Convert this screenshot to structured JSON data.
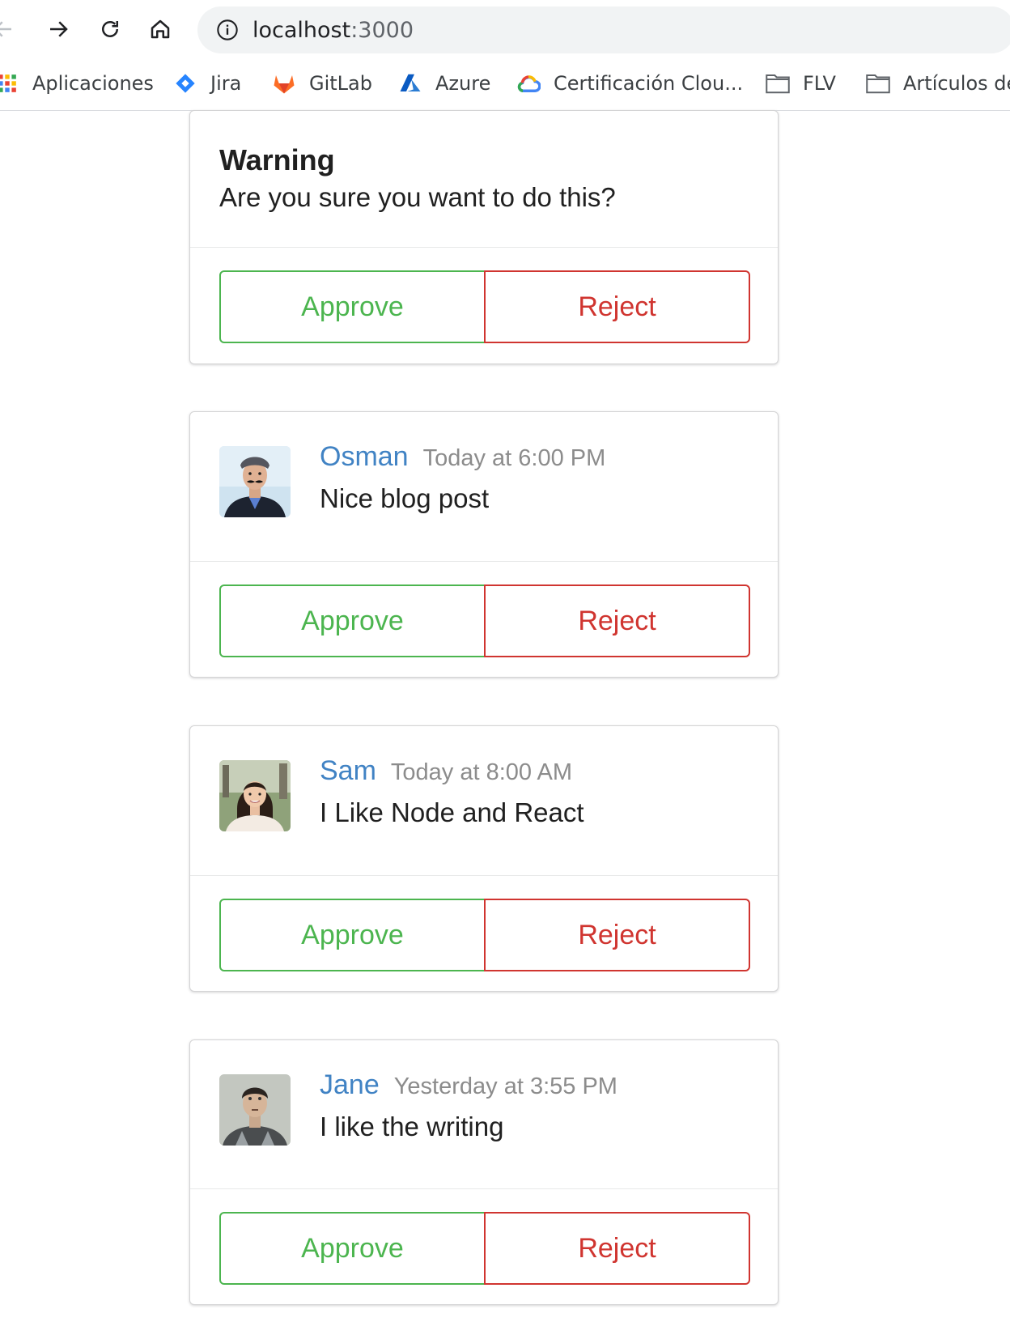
{
  "browser": {
    "url_host": "localhost",
    "url_port": ":3000",
    "bookmarks": [
      {
        "label": "Aplicaciones",
        "icon": "apps-grid-icon"
      },
      {
        "label": "Jira",
        "icon": "jira-icon"
      },
      {
        "label": "GitLab",
        "icon": "gitlab-icon"
      },
      {
        "label": "Azure",
        "icon": "azure-icon"
      },
      {
        "label": "Certificación Clou...",
        "icon": "google-cloud-icon"
      },
      {
        "label": "FLV",
        "icon": "folder-icon"
      },
      {
        "label": "Artículos de",
        "icon": "folder-icon"
      }
    ]
  },
  "warning": {
    "title": "Warning",
    "text": "Are you sure you want to do this?",
    "approve_label": "Approve",
    "reject_label": "Reject"
  },
  "comments": [
    {
      "author": "Osman",
      "time": "Today at 6:00 PM",
      "text": "Nice blog post",
      "approve_label": "Approve",
      "reject_label": "Reject"
    },
    {
      "author": "Sam",
      "time": "Today at 8:00 AM",
      "text": "I Like Node and React",
      "approve_label": "Approve",
      "reject_label": "Reject"
    },
    {
      "author": "Jane",
      "time": "Yesterday at 3:55 PM",
      "text": "I like the writing",
      "approve_label": "Approve",
      "reject_label": "Reject"
    }
  ],
  "colors": {
    "approve": "#4cb54f",
    "reject": "#d03530",
    "author": "#4183c4",
    "metadata": "#8c8c8c"
  }
}
